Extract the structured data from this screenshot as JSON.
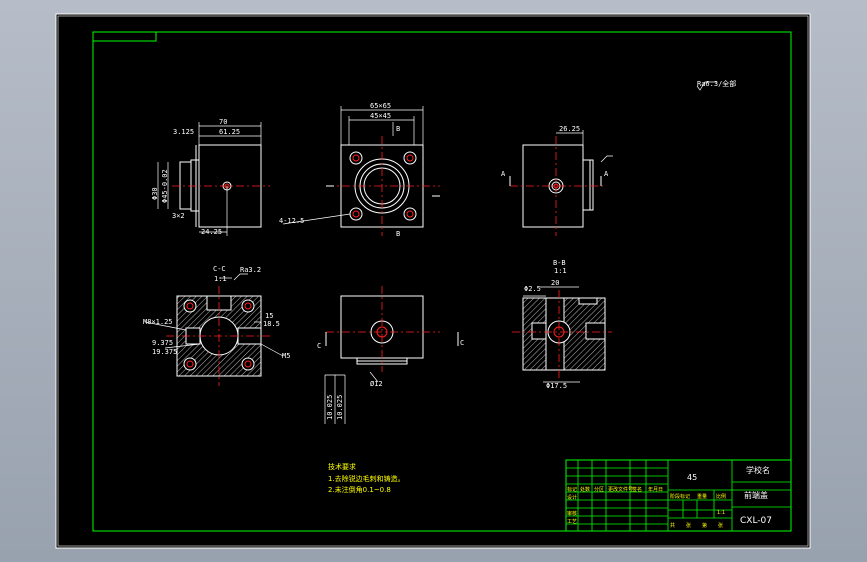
{
  "drawing": {
    "roughness_symbol": "Ra6.3/全部",
    "views": {
      "top_left": {
        "dims": [
          "70",
          "61.25",
          "3.125",
          "Φ30",
          "Φ45-0.02",
          "3×2",
          "24.25"
        ]
      },
      "top_center": {
        "dims": [
          "65×65",
          "45×45",
          "B",
          "4-12.5",
          "B"
        ]
      },
      "top_right": {
        "dims": [
          "26.25",
          "A",
          "A"
        ]
      },
      "bottom_left": {
        "dims": [
          "C-C",
          "1:1",
          "Ra3.2",
          "15",
          "18.5",
          "M8×1.25",
          "9.375",
          "19.375",
          "M5"
        ]
      },
      "bottom_center": {
        "dims": [
          "C",
          "C",
          "Ø12",
          "10.025",
          "10.025"
        ]
      },
      "bottom_right": {
        "dims": [
          "B-B",
          "1:1",
          "Φ2.5",
          "20",
          "Φ17.5"
        ]
      }
    },
    "notes": {
      "title": "技术要求",
      "line1": "1.去除锐边毛刺和铸造。",
      "line2": "2.未注倒角0.1~0.8"
    },
    "title_block": {
      "material": "45",
      "school": "学校名",
      "part_name": "前端盖",
      "drawing_no": "CXL-07",
      "headers": [
        "标记",
        "处数",
        "分区",
        "更改文件号",
        "签名",
        "年月日"
      ],
      "rows": [
        "设计",
        "审核",
        "工艺"
      ],
      "stage": [
        "阶段标记",
        "重量",
        "比例"
      ],
      "scale": "1:1",
      "sheet": [
        "共",
        "张",
        "第",
        "张"
      ]
    }
  },
  "colors": {
    "background": "#000000",
    "frame": "#00ff00",
    "lines": "#ffffff",
    "center_lines": "#ff2020",
    "text": "#ffff00",
    "viewport_bg": "#a4acb9"
  }
}
